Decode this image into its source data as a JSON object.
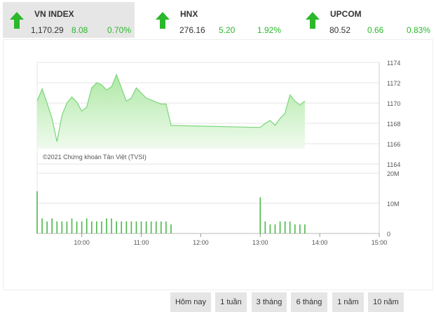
{
  "indices": [
    {
      "name": "VN INDEX",
      "last": "1,170.29",
      "change": "8.08",
      "percent": "0.70%"
    },
    {
      "name": "HNX",
      "last": "276.16",
      "change": "5.20",
      "percent": "1.92%"
    },
    {
      "name": "UPCOM",
      "last": "80.52",
      "change": "0.66",
      "percent": "0.83%"
    }
  ],
  "colors": {
    "up": "#2bb82b",
    "area_fill": "#c8f0c0",
    "line": "#7bd67b",
    "volume": "#49b849"
  },
  "chart": {
    "watermark": "©2021 Chứng khoán Tân Việt (TVSI)",
    "price_ticks": [
      "1174",
      "1172",
      "1170",
      "1168",
      "1166",
      "1164"
    ],
    "volume_ticks": [
      "20M",
      "10M",
      "0"
    ],
    "time_ticks": [
      "10:00",
      "11:00",
      "12:00",
      "13:00",
      "14:00",
      "15:00"
    ]
  },
  "chart_data": {
    "type": "area",
    "ylim": [
      1164,
      1174
    ],
    "x": [
      "09:15",
      "09:20",
      "09:25",
      "09:30",
      "09:35",
      "09:40",
      "09:45",
      "09:50",
      "09:55",
      "10:00",
      "10:05",
      "10:10",
      "10:15",
      "10:20",
      "10:25",
      "10:30",
      "10:35",
      "10:40",
      "10:45",
      "10:50",
      "10:55",
      "11:00",
      "11:05",
      "11:10",
      "11:15",
      "11:20",
      "11:25",
      "11:30",
      "13:00",
      "13:05",
      "13:10",
      "13:15",
      "13:20",
      "13:25",
      "13:30",
      "13:35",
      "13:40",
      "13:45"
    ],
    "price": [
      1170.2,
      1171.4,
      1170.0,
      1168.5,
      1166.2,
      1168.8,
      1170.0,
      1170.6,
      1170.1,
      1169.2,
      1169.6,
      1171.5,
      1172.0,
      1171.8,
      1171.3,
      1171.6,
      1172.8,
      1171.5,
      1170.2,
      1170.5,
      1171.5,
      1171.0,
      1170.5,
      1170.3,
      1170.1,
      1169.9,
      1169.9,
      1167.8,
      1167.6,
      1168.0,
      1168.3,
      1167.8,
      1168.5,
      1169.0,
      1170.8,
      1170.2,
      1169.8,
      1170.2
    ],
    "volume_m": [
      14,
      5,
      4,
      5,
      4,
      4,
      4,
      5,
      4,
      4,
      5,
      4,
      4,
      4,
      5,
      5,
      4,
      4,
      4,
      4,
      4,
      4,
      4,
      4,
      4,
      4,
      4,
      3,
      12,
      4,
      3,
      3,
      4,
      4,
      4,
      3,
      3,
      3
    ]
  },
  "periods": [
    "Hôm nay",
    "1 tuần",
    "3 tháng",
    "6 tháng",
    "1 năm",
    "10 năm"
  ]
}
